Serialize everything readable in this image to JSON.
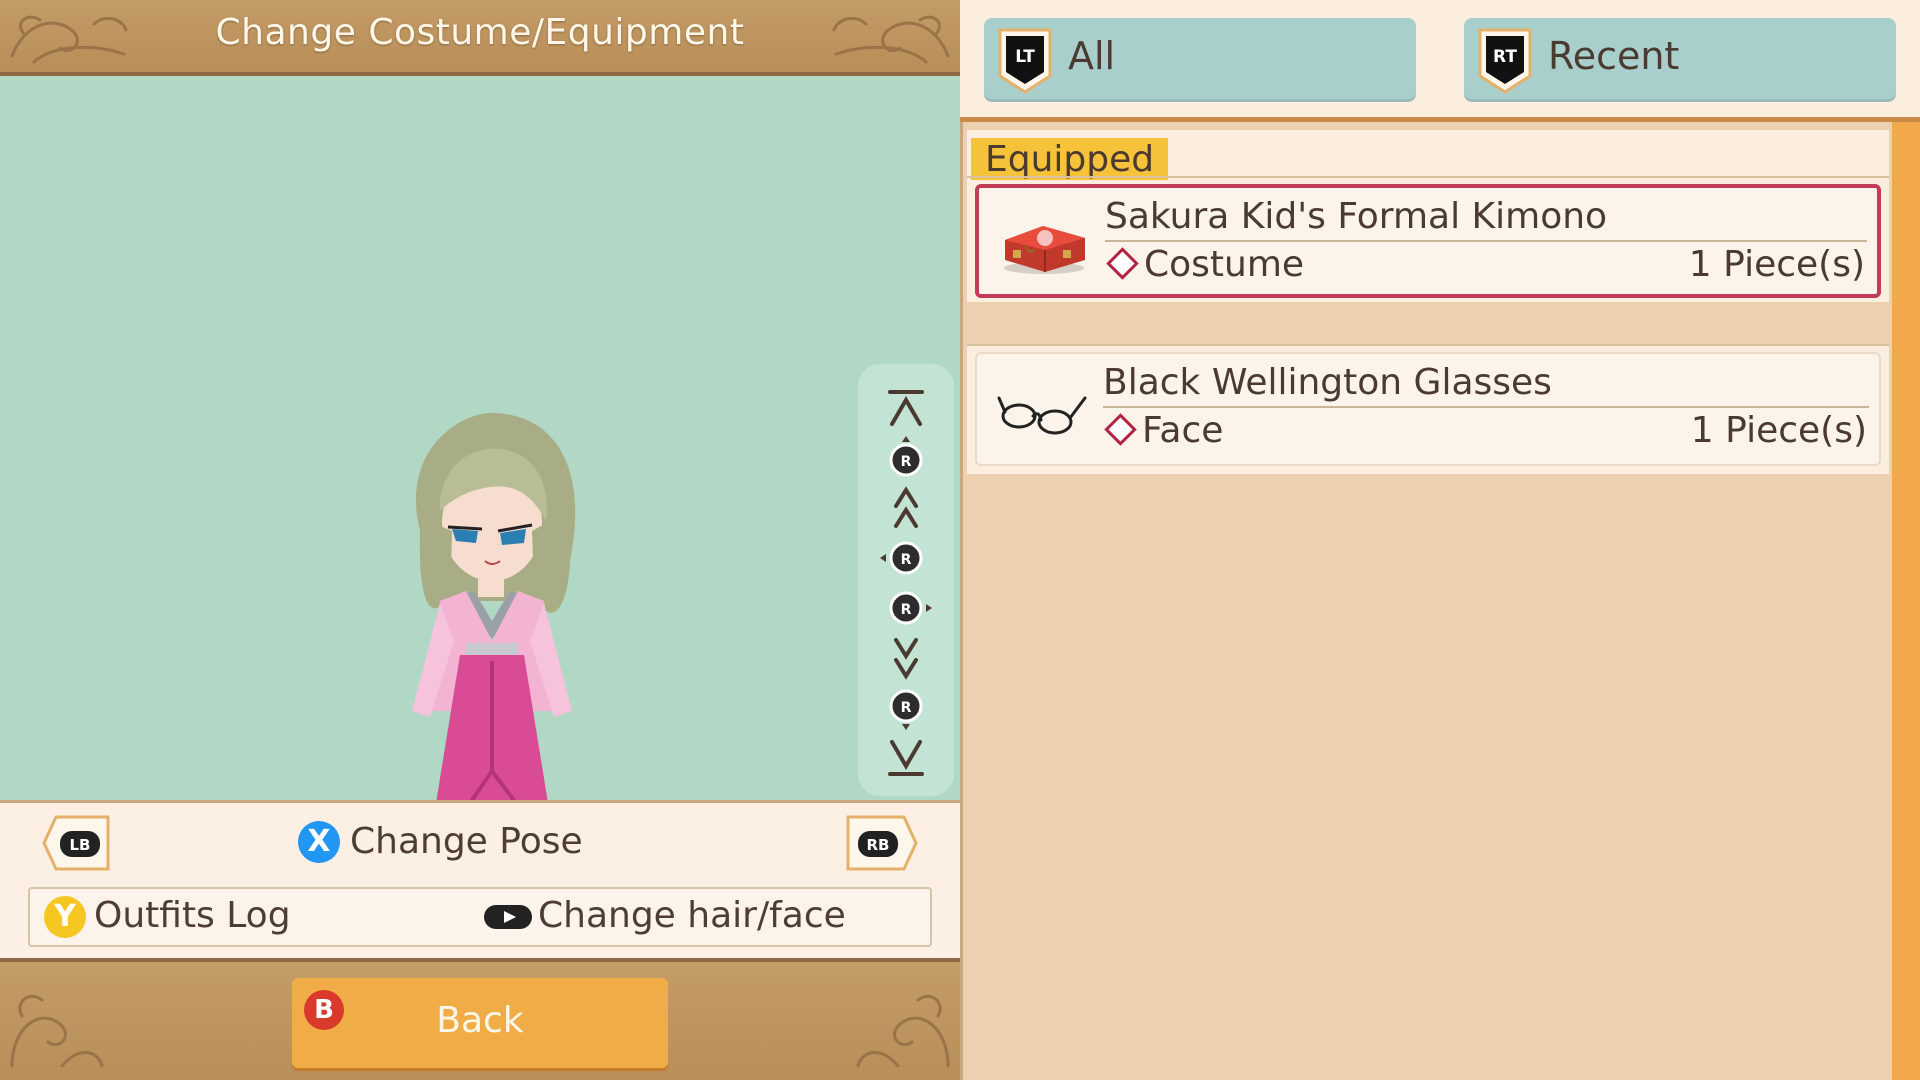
{
  "header": {
    "title": "Change Costume/Equipment"
  },
  "preview_controls": {
    "lb": "LB",
    "rb": "RB",
    "change_pose": {
      "button": "X",
      "label": "Change Pose"
    },
    "outfits_log": {
      "button": "Y",
      "label": "Outfits Log"
    },
    "change_hair_face": {
      "label": "Change hair/face"
    },
    "camera_stick": "R"
  },
  "footer": {
    "back": {
      "button": "B",
      "label": "Back"
    }
  },
  "tabs": [
    {
      "badge": "LT",
      "label": "All"
    },
    {
      "badge": "RT",
      "label": "Recent"
    }
  ],
  "list": {
    "section_label": "Equipped",
    "items": [
      {
        "name": "Sakura Kid's Formal Kimono",
        "category": "Costume",
        "count": "1 Piece(s)",
        "icon": "kimono-box-icon",
        "selected": true
      },
      {
        "name": "Black Wellington Glasses",
        "category": "Face",
        "count": "1 Piece(s)",
        "icon": "glasses-icon",
        "selected": false
      }
    ]
  },
  "colors": {
    "accent_selected": "#c23c58",
    "tab_bg": "#a9cfcd",
    "equipped_tag": "#f6c23a",
    "scrollbar": "#f1a94c",
    "preview_bg": "#b0d8c5",
    "back_button": "#f0ac46"
  }
}
